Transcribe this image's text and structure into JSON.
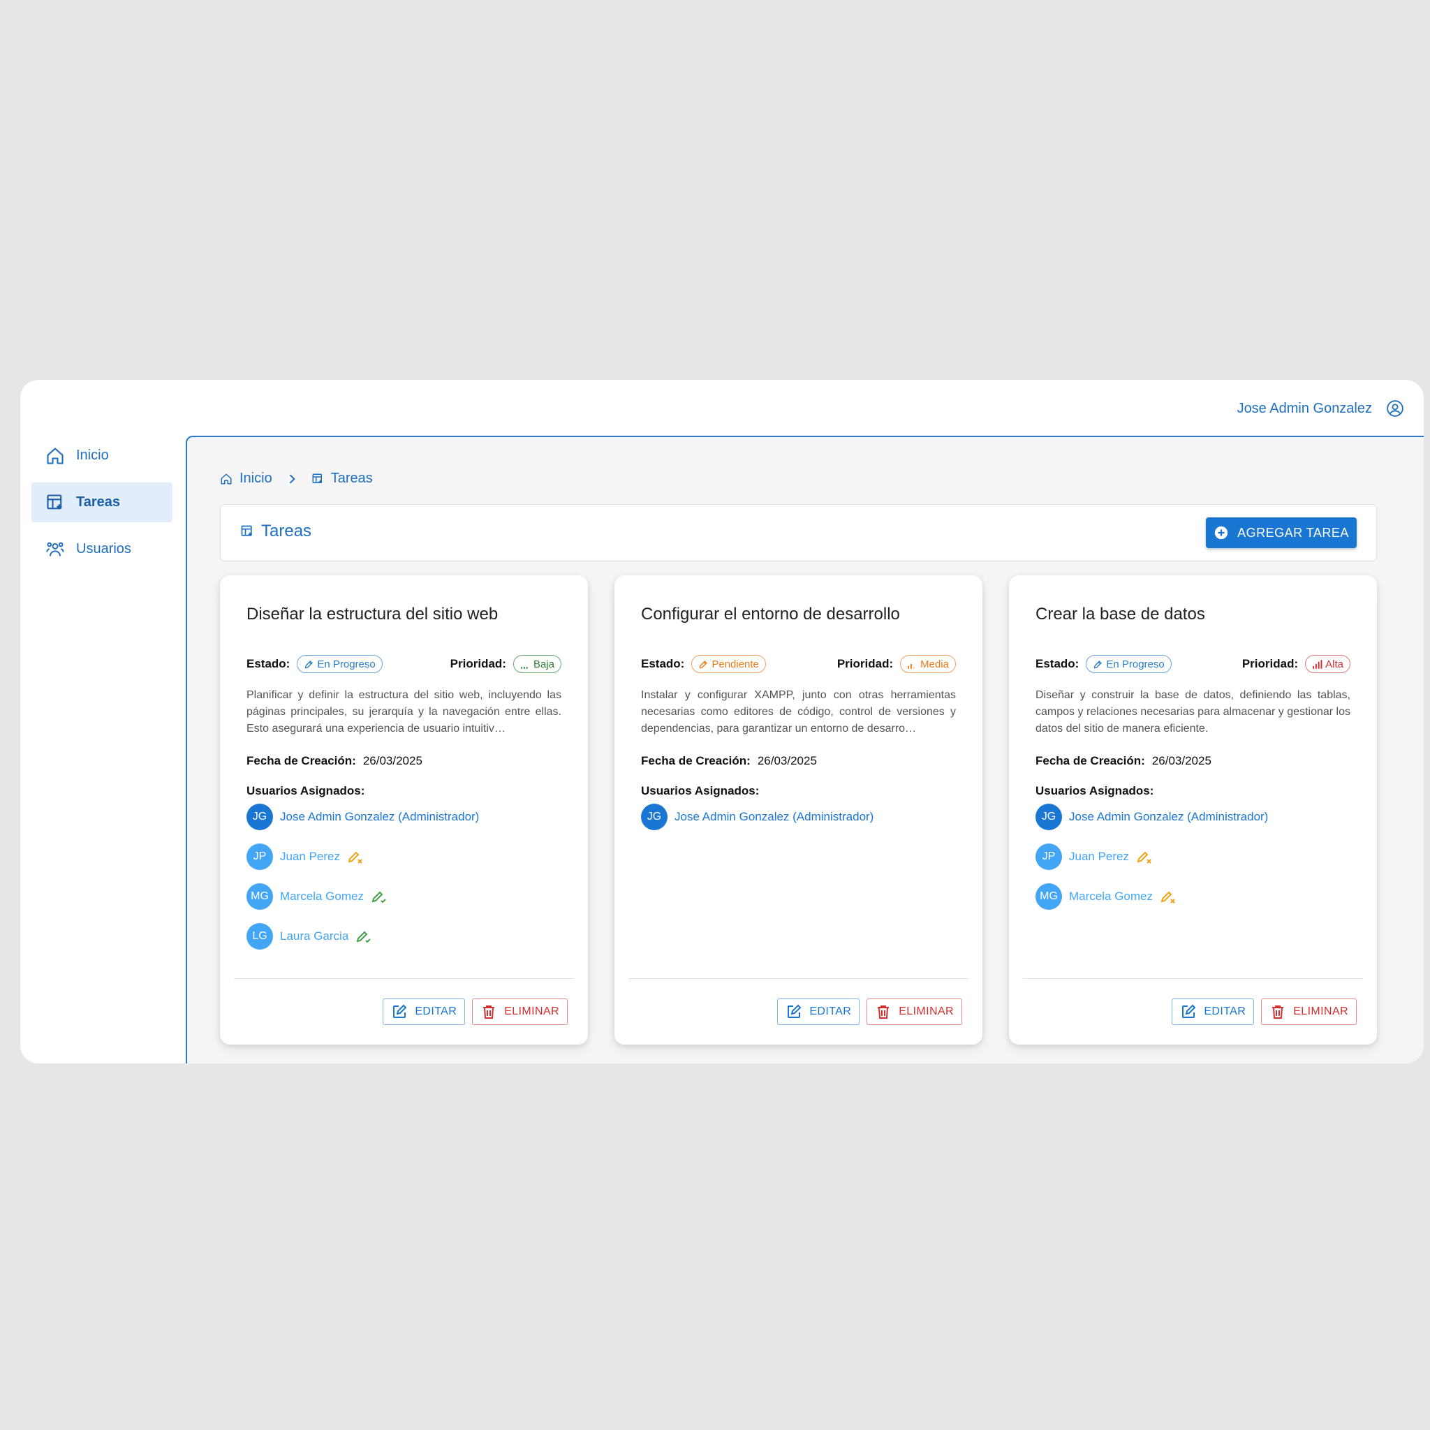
{
  "topbar": {
    "user_name": "Jose Admin Gonzalez"
  },
  "sidebar": {
    "items": [
      {
        "label": "Inicio"
      },
      {
        "label": "Tareas"
      },
      {
        "label": "Usuarios"
      }
    ]
  },
  "breadcrumb": {
    "home": "Inicio",
    "current": "Tareas"
  },
  "header": {
    "title": "Tareas",
    "add_label": "AGREGAR TAREA"
  },
  "labels": {
    "estado": "Estado:",
    "prioridad": "Prioridad:",
    "fecha": "Fecha de Creación:",
    "asignados": "Usuarios Asignados:",
    "edit": "EDITAR",
    "delete": "ELIMINAR"
  },
  "cards": [
    {
      "title": "Diseñar la estructura del sitio web",
      "estado": "En Progreso",
      "prioridad": "Baja",
      "description": "Planificar y definir la estructura del sitio web, incluyendo las páginas principales, su jerarquía y la navegación entre ellas. Esto asegurará una experiencia de usuario intuitiv…",
      "fecha": "26/03/2025",
      "users": [
        {
          "initials": "JG",
          "name": "Jose Admin Gonzalez (Administrador)"
        },
        {
          "initials": "JP",
          "name": "Juan Perez"
        },
        {
          "initials": "MG",
          "name": "Marcela Gomez"
        },
        {
          "initials": "LG",
          "name": "Laura Garcia"
        }
      ]
    },
    {
      "title": "Configurar el entorno de desarrollo",
      "estado": "Pendiente",
      "prioridad": "Media",
      "description": "Instalar y configurar XAMPP, junto con otras herramientas necesarias como editores de código, control de versiones y dependencias, para garantizar un entorno de desarro…",
      "fecha": "26/03/2025",
      "users": [
        {
          "initials": "JG",
          "name": "Jose Admin Gonzalez (Administrador)"
        }
      ]
    },
    {
      "title": "Crear la base de datos",
      "estado": "En Progreso",
      "prioridad": "Alta",
      "description": "Diseñar y construir la base de datos, definiendo las tablas, campos y relaciones necesarias para almacenar y gestionar los datos del sitio de manera eficiente.",
      "fecha": "26/03/2025",
      "users": [
        {
          "initials": "JG",
          "name": "Jose Admin Gonzalez (Administrador)"
        },
        {
          "initials": "JP",
          "name": "Juan Perez"
        },
        {
          "initials": "MG",
          "name": "Marcela Gomez"
        }
      ]
    }
  ]
}
